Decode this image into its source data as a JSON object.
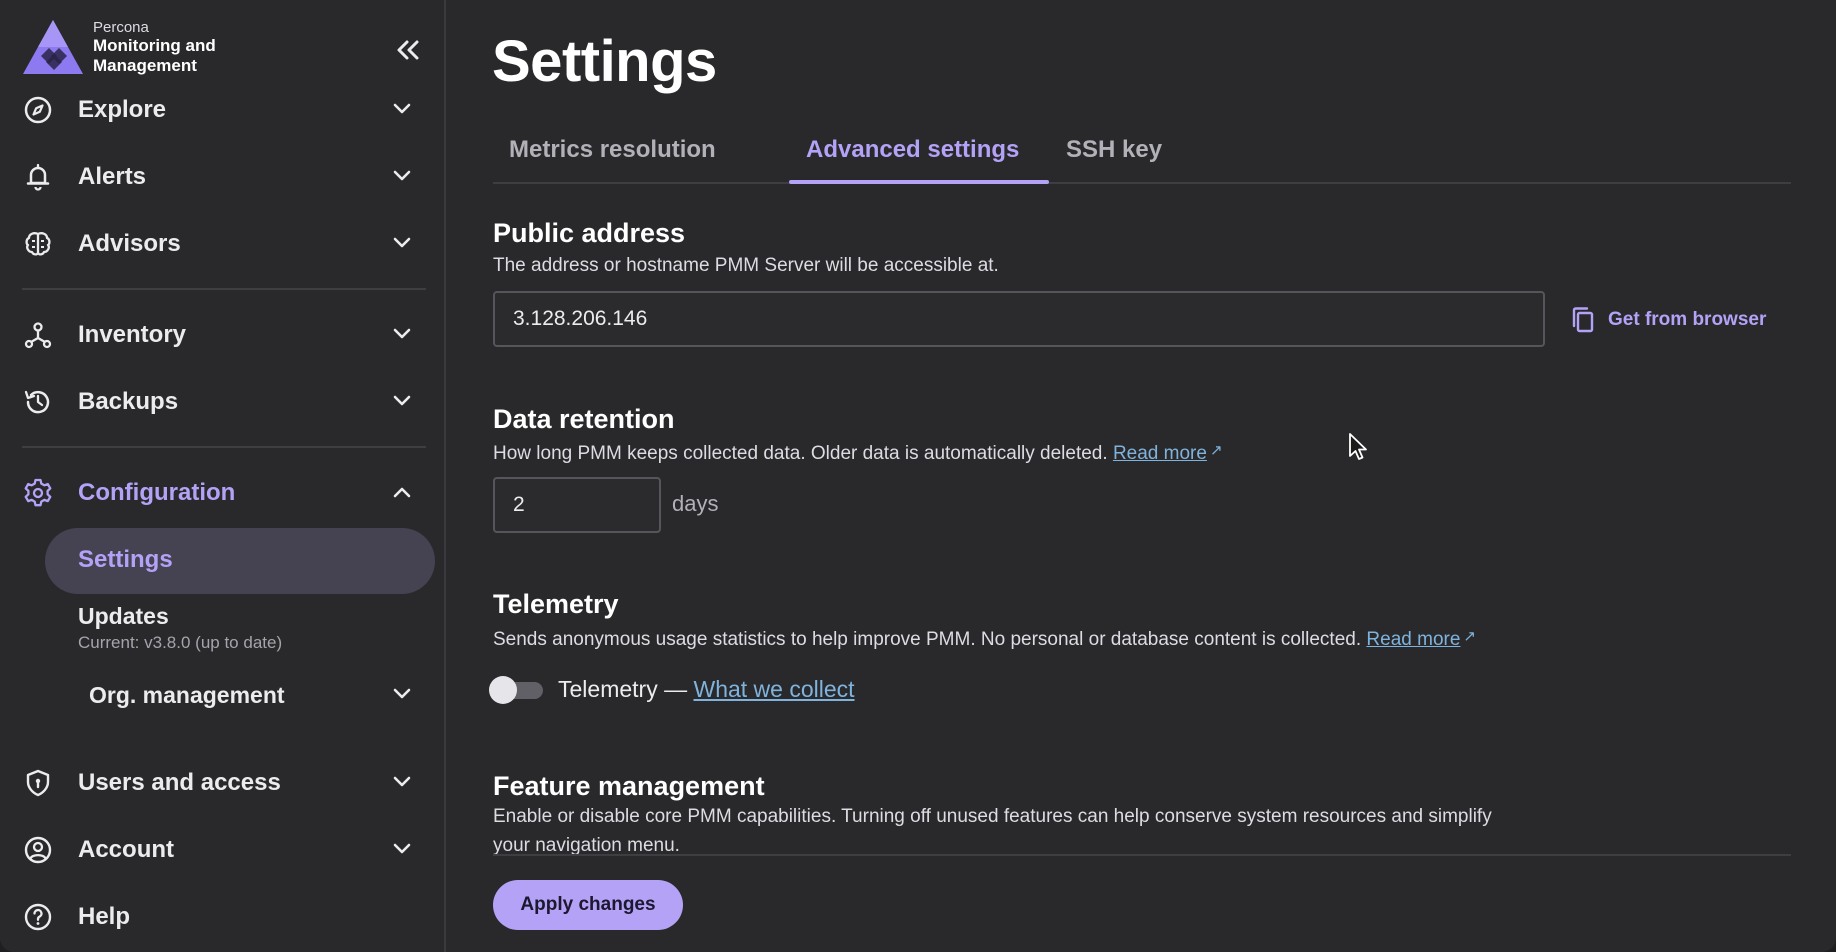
{
  "brand": {
    "small": "Percona",
    "big": "Monitoring and Management"
  },
  "sidebar": {
    "items": [
      {
        "label": "Explore"
      },
      {
        "label": "Alerts"
      },
      {
        "label": "Advisors"
      },
      {
        "label": "Inventory"
      },
      {
        "label": "Backups"
      },
      {
        "label": "Configuration"
      },
      {
        "label": "Users and access"
      },
      {
        "label": "Account"
      },
      {
        "label": "Help"
      }
    ],
    "configuration": {
      "settings_label": "Settings",
      "updates_label": "Updates",
      "updates_caption": "Current: v3.8.0 (up to date)",
      "org_label": "Org. management"
    }
  },
  "page": {
    "title": "Settings",
    "tabs": [
      {
        "label": "Metrics resolution"
      },
      {
        "label": "Advanced settings"
      },
      {
        "label": "SSH key"
      }
    ]
  },
  "public_address": {
    "title": "Public address",
    "description": "The address or hostname PMM Server will be accessible at.",
    "value": "3.128.206.146",
    "get_from_browser": "Get from browser"
  },
  "data_retention": {
    "title": "Data retention",
    "description": "How long PMM keeps collected data. Older data is automatically deleted.",
    "read_more": "Read more",
    "value": "2",
    "unit": "days"
  },
  "telemetry": {
    "title": "Telemetry",
    "description": "Sends anonymous usage statistics to help improve PMM. No personal or database content is collected.",
    "read_more": "Read more",
    "toggle_label": "Telemetry —",
    "what_we_collect": "What we collect",
    "enabled": false
  },
  "feature_management": {
    "title": "Feature management",
    "description": "Enable or disable core PMM capabilities. Turning off unused features can help conserve system resources and simplify your navigation menu."
  },
  "actions": {
    "apply": "Apply changes"
  },
  "colors": {
    "accent": "#b4a2f6",
    "link": "#7fb3dc",
    "background": "#29292c"
  },
  "icons": {
    "explore": "compass-icon",
    "alerts": "bell-icon",
    "advisors": "brain-icon",
    "inventory": "nodes-icon",
    "backups": "history-icon",
    "configuration": "gear-icon",
    "users": "shield-icon",
    "account": "user-circle-icon",
    "help": "question-circle-icon"
  }
}
